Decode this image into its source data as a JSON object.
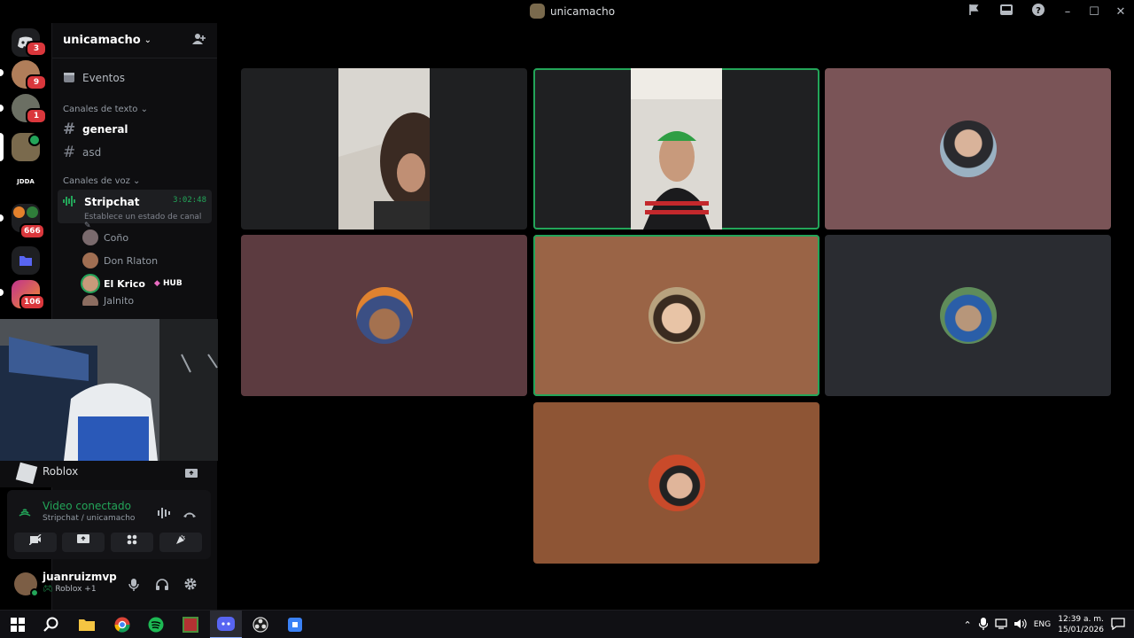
{
  "window": {
    "title": "unicamacho"
  },
  "rail": {
    "badges": [
      "3",
      "9",
      "1",
      "666",
      "106"
    ],
    "jdda_label": "JDDA"
  },
  "sidebar": {
    "guild_name": "unicamacho",
    "events_label": "Eventos",
    "text_category": "Canales de texto",
    "text_channels": [
      {
        "name": "general"
      },
      {
        "name": "asd"
      }
    ],
    "voice_category": "Canales de voz",
    "voice_channel": {
      "name": "Stripchat",
      "timer": "3:02:48",
      "status": "Establece un estado de canal"
    },
    "members": [
      {
        "name": "Coño"
      },
      {
        "name": "Don Rlaton"
      },
      {
        "name": "El Krico",
        "tag": "HUB"
      },
      {
        "name": "Jalnito"
      }
    ]
  },
  "activity": {
    "game": "Roblox"
  },
  "voice_panel": {
    "status": "Video conectado",
    "location": "Stripchat / unicamacho"
  },
  "user": {
    "name": "juanruizmvp",
    "status": "Roblox +1"
  },
  "tiles": [
    {
      "kind": "camera",
      "speaking": false,
      "bg": "#1f2022"
    },
    {
      "kind": "camera",
      "speaking": true,
      "bg": "#1f2022"
    },
    {
      "kind": "avatar",
      "speaking": false,
      "bg": "#7a5457"
    },
    {
      "kind": "avatar",
      "speaking": false,
      "bg": "#5c3b40"
    },
    {
      "kind": "avatar",
      "speaking": true,
      "bg": "#9a6446"
    },
    {
      "kind": "avatar",
      "speaking": false,
      "bg": "#2a2c31"
    },
    {
      "kind": "avatar",
      "speaking": false,
      "bg": "#8e5535"
    }
  ],
  "taskbar": {
    "lang": "ENG",
    "time": "12:39 a. m.",
    "date": "15/01/2026"
  },
  "colors": {
    "connected": "#23a559",
    "badge": "#da373c",
    "accent": "#5865f2"
  }
}
